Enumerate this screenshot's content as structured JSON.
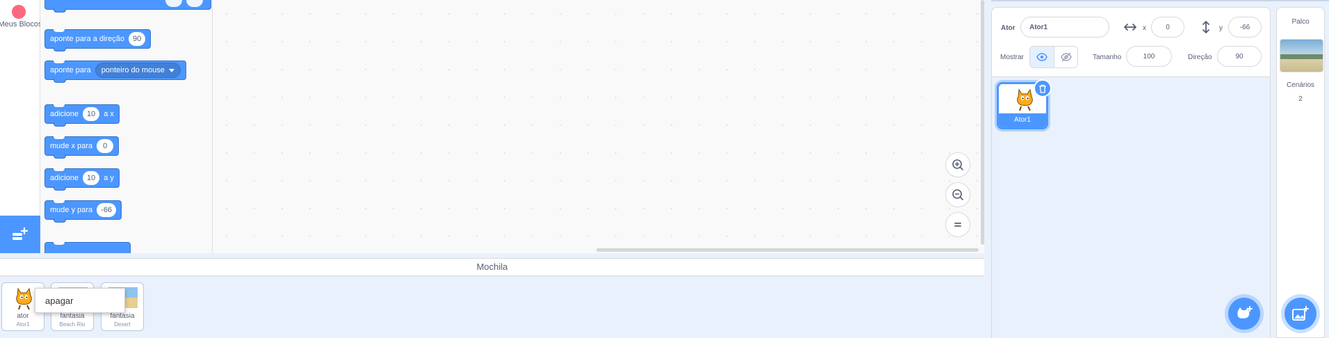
{
  "categories": {
    "my_blocks_label": "Meus Blocos"
  },
  "palette": {
    "blocks": [
      {
        "text": "aponte  para a direção",
        "value": "90"
      },
      {
        "text": "aponte para",
        "dropdown": "ponteiro do mouse"
      },
      {
        "text": "adicione",
        "value": "10",
        "suffix": "a x"
      },
      {
        "text": "mude x para",
        "value": "0"
      },
      {
        "text": "adicione",
        "value": "10",
        "suffix": "a y"
      },
      {
        "text": "mude y para",
        "value": "-66"
      }
    ]
  },
  "backpack": {
    "title": "Mochila",
    "items": [
      {
        "name": "ator",
        "sub": "Ator1"
      },
      {
        "name": "fantasia",
        "sub": "Beach Rio"
      },
      {
        "name": "fantasia",
        "sub": "Desert"
      }
    ],
    "context_menu": {
      "delete_label": "apagar"
    }
  },
  "sprite_info": {
    "sprite_label": "Ator",
    "sprite_name": "Ator1",
    "x_label": "x",
    "x_value": "0",
    "y_label": "y",
    "y_value": "-66",
    "show_label": "Mostrar",
    "size_label": "Tamanho",
    "size_value": "100",
    "direction_label": "Direção",
    "direction_value": "90"
  },
  "sprites": [
    {
      "name": "Ator1",
      "selected": true
    }
  ],
  "stage": {
    "title": "Palco",
    "backdrops_label": "Cenários",
    "backdrops_count": "2"
  },
  "colors": {
    "accent": "#4c97ff",
    "motion_block": "#4c97ff",
    "my_blocks_dot": "#ff6680",
    "pane_background": "#e9f1fc"
  }
}
